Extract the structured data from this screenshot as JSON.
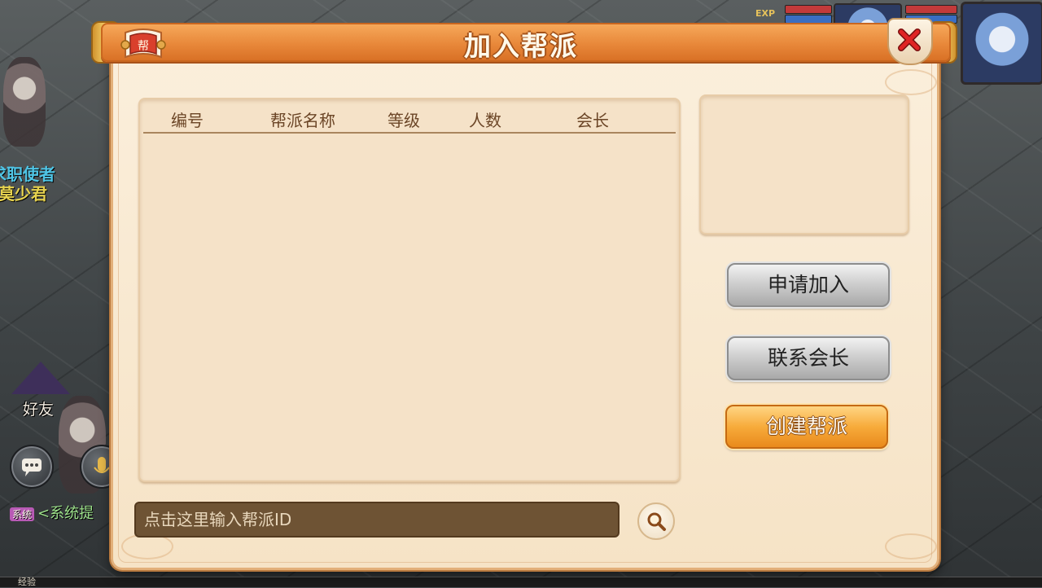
{
  "dialog": {
    "title": "加入帮派",
    "emblem_text": "帮"
  },
  "table": {
    "columns": [
      "编号",
      "帮派名称",
      "等级",
      "人数",
      "会长"
    ],
    "rows": []
  },
  "buttons": {
    "apply_join": "申请加入",
    "contact_leader": "联系会长",
    "create_guild": "创建帮派"
  },
  "search": {
    "placeholder": "点击这里输入帮派ID",
    "value": ""
  },
  "background": {
    "exp_label": "EXP",
    "npc_name_1": "求职使者",
    "npc_name_2": "莫少君",
    "friends_label": "好友",
    "system_badge": "系统",
    "system_text": "<系统提",
    "bottom_label": "经验"
  },
  "colors": {
    "title_bar": "#e8883a",
    "panel_bg": "#f5e2c8",
    "create_button": "#f7ab3b",
    "close_x": "#d11e1e"
  }
}
